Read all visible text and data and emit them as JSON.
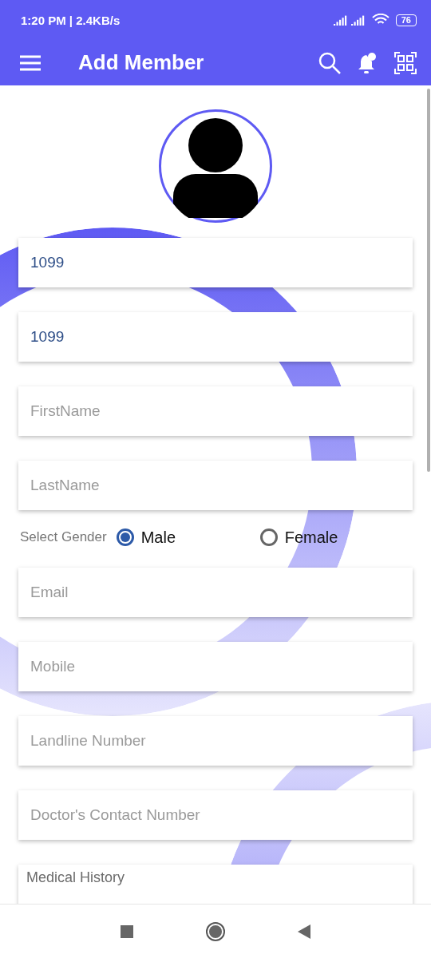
{
  "status_bar": {
    "time": "1:20 PM | 2.4KB/s",
    "battery": "76"
  },
  "app_bar": {
    "title": "Add Member"
  },
  "fields": [
    {
      "kind": "input",
      "value": "1099"
    },
    {
      "kind": "input",
      "value": "1099"
    },
    {
      "kind": "input",
      "placeholder": "FirstName"
    },
    {
      "kind": "input",
      "placeholder": "LastName"
    },
    {
      "kind": "gender",
      "label": "Select Gender",
      "options": [
        {
          "label": "Male",
          "selected": true
        },
        {
          "label": "Female",
          "selected": false
        }
      ]
    },
    {
      "kind": "input",
      "placeholder": "Email"
    },
    {
      "kind": "input",
      "placeholder": "Mobile"
    },
    {
      "kind": "input",
      "placeholder": "Landline Number"
    },
    {
      "kind": "input",
      "placeholder": "Doctor's Contact Number"
    },
    {
      "kind": "labeled",
      "label": "Medical History"
    }
  ]
}
